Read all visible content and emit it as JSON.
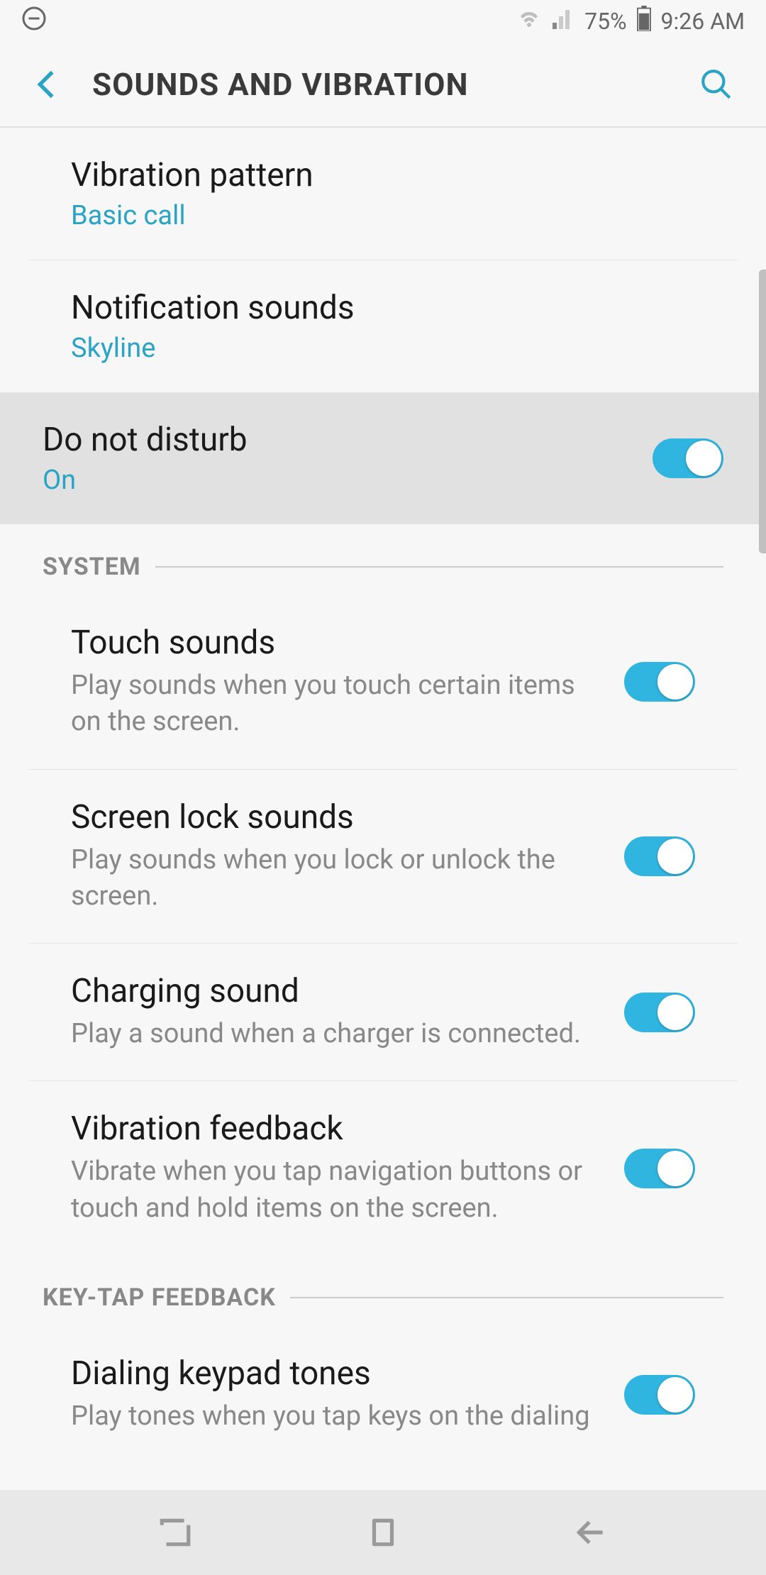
{
  "status": {
    "battery": "75%",
    "time": "9:26 AM"
  },
  "header": {
    "title": "SOUNDS AND VIBRATION"
  },
  "settings": {
    "vibration_pattern": {
      "title": "Vibration pattern",
      "value": "Basic call"
    },
    "notification_sounds": {
      "title": "Notification sounds",
      "value": "Skyline"
    },
    "dnd": {
      "title": "Do not disturb",
      "value": "On"
    },
    "touch_sounds": {
      "title": "Touch sounds",
      "desc": "Play sounds when you touch certain items on the screen."
    },
    "screen_lock": {
      "title": "Screen lock sounds",
      "desc": "Play sounds when you lock or unlock the screen."
    },
    "charging": {
      "title": "Charging sound",
      "desc": "Play a sound when a charger is connected."
    },
    "vibration_feedback": {
      "title": "Vibration feedback",
      "desc": "Vibrate when you tap navigation buttons or touch and hold items on the screen."
    },
    "dialing": {
      "title": "Dialing keypad tones",
      "desc": "Play tones when you tap keys on the dialing"
    }
  },
  "sections": {
    "system": "SYSTEM",
    "keytap": "KEY-TAP FEEDBACK"
  }
}
